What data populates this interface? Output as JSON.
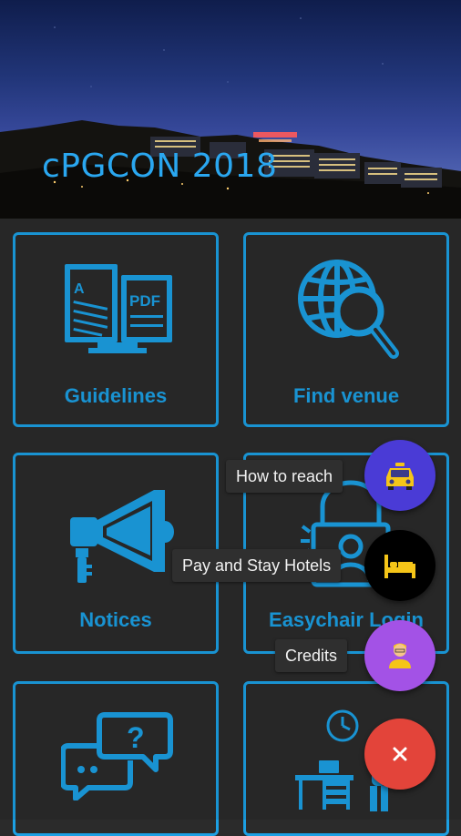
{
  "header": {
    "title": "cPGCON 2018"
  },
  "tiles": [
    {
      "label": "Guidelines",
      "icon": "guidelines-pdf-book-icon"
    },
    {
      "label": "Find venue",
      "icon": "globe-search-icon"
    },
    {
      "label": "Notices",
      "icon": "megaphone-icon"
    },
    {
      "label": "Easychair Login",
      "icon": "lock-user-icon"
    },
    {
      "label": "",
      "icon": "chat-question-icon"
    },
    {
      "label": "",
      "icon": "desk-clock-icon"
    }
  ],
  "fab_menu": {
    "items": [
      {
        "label": "How to reach",
        "icon": "taxi-icon",
        "color": "#4a3bd6"
      },
      {
        "label": "Pay and Stay Hotels",
        "icon": "bed-icon",
        "color": "#000000"
      },
      {
        "label": "Credits",
        "icon": "person-icon",
        "color": "#a352e6"
      }
    ],
    "close": {
      "icon": "close-icon",
      "color": "#e3443a"
    }
  },
  "colors": {
    "accent": "#1ca0e4",
    "background": "#2b2b2b"
  }
}
